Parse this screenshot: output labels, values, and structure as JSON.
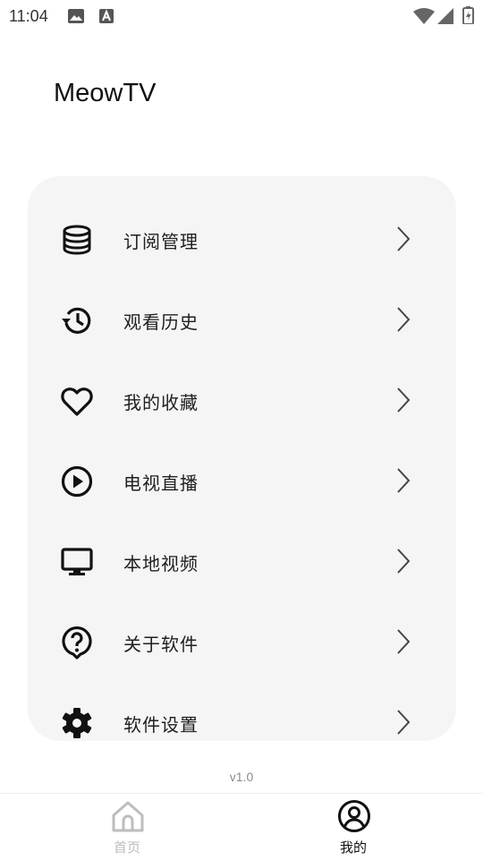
{
  "status_bar": {
    "time": "11:04"
  },
  "header": {
    "title": "MeowTV"
  },
  "menu": {
    "items": [
      {
        "label": "订阅管理",
        "icon": "database-icon"
      },
      {
        "label": "观看历史",
        "icon": "history-icon"
      },
      {
        "label": "我的收藏",
        "icon": "heart-icon"
      },
      {
        "label": "电视直播",
        "icon": "play-circle-icon"
      },
      {
        "label": "本地视频",
        "icon": "monitor-icon"
      },
      {
        "label": "关于软件",
        "icon": "help-icon"
      },
      {
        "label": "软件设置",
        "icon": "gear-icon"
      }
    ]
  },
  "version": "v1.0",
  "bottom_nav": {
    "tabs": [
      {
        "label": "首页",
        "icon": "home-icon",
        "active": false
      },
      {
        "label": "我的",
        "icon": "profile-icon",
        "active": true
      }
    ]
  },
  "colors": {
    "active_tab": "#111111",
    "inactive_tab": "#bdbdbd",
    "card_bg": "#f5f5f5"
  }
}
